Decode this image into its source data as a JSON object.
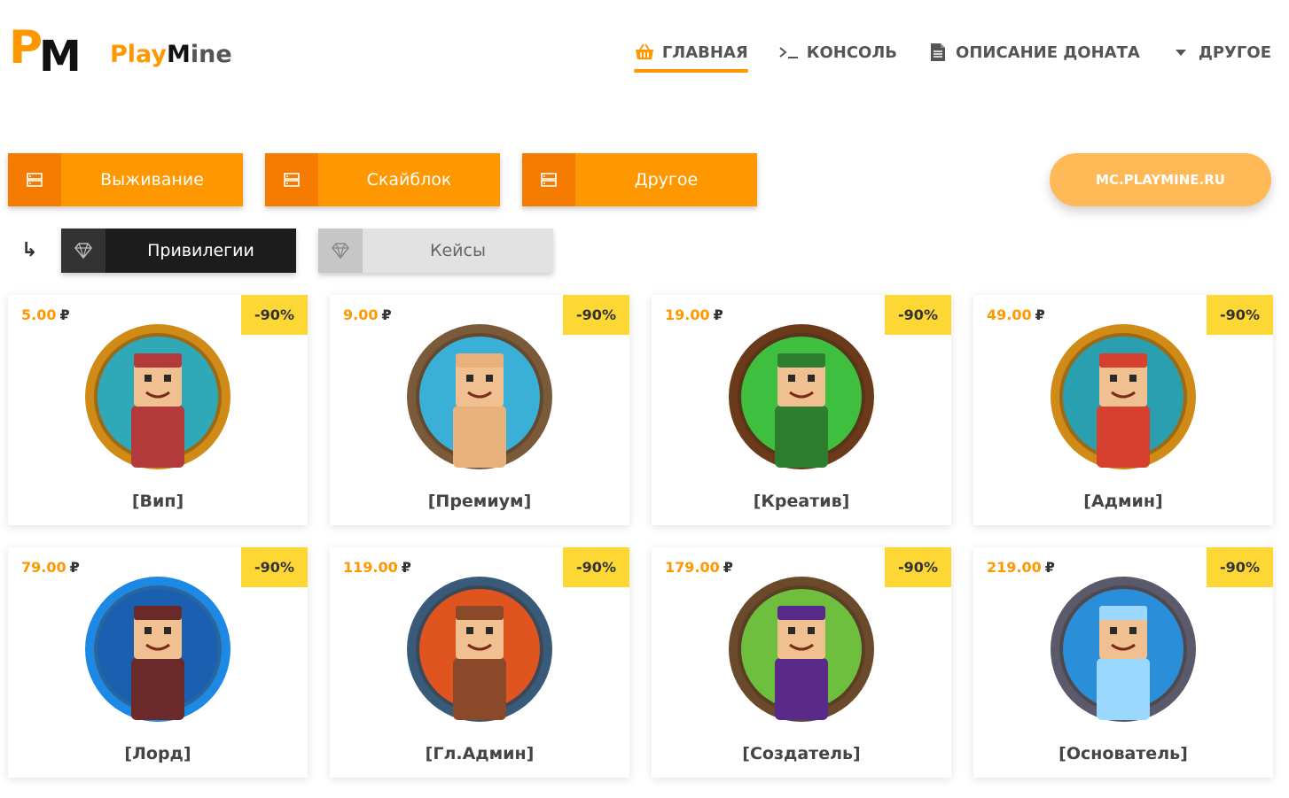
{
  "logo": {
    "mark_p": "P",
    "mark_m": "M",
    "text_part1": "Play",
    "text_part2": "M",
    "text_part3": "ine"
  },
  "nav": [
    {
      "label": "ГЛАВНАЯ",
      "icon": "basket-icon"
    },
    {
      "label": "КОНСОЛЬ",
      "icon": "terminal-icon"
    },
    {
      "label": "ОПИСАНИЕ ДОНАТА",
      "icon": "document-icon"
    },
    {
      "label": "ДРУГОЕ",
      "icon": "caret-down-icon"
    }
  ],
  "servers": [
    {
      "label": "Выживание",
      "icon": "server-icon"
    },
    {
      "label": "Скайблок",
      "icon": "server-icon"
    },
    {
      "label": "Другое",
      "icon": "server-icon"
    }
  ],
  "server_ip": "MC.PLAYMINE.RU",
  "categories": [
    {
      "label": "Привилегии",
      "icon": "diamond-icon",
      "active": true
    },
    {
      "label": "Кейсы",
      "icon": "diamond-icon",
      "active": false
    }
  ],
  "currency": "₽",
  "products": [
    {
      "name": "[Вип]",
      "price": "5.00",
      "discount": "-90%",
      "colors": {
        "ring": "#d08a16",
        "bg": "#2fa9b8",
        "char": "#b33a3a"
      }
    },
    {
      "name": "[Премиум]",
      "price": "9.00",
      "discount": "-90%",
      "colors": {
        "ring": "#7a5a3a",
        "bg": "#3ab0d8",
        "char": "#e8b07a"
      }
    },
    {
      "name": "[Креатив]",
      "price": "19.00",
      "discount": "-90%",
      "colors": {
        "ring": "#6a3a1a",
        "bg": "#3fbf3f",
        "char": "#2f7d2f"
      }
    },
    {
      "name": "[Админ]",
      "price": "49.00",
      "discount": "-90%",
      "colors": {
        "ring": "#d08a16",
        "bg": "#2a9fb0",
        "char": "#d6402f"
      }
    },
    {
      "name": "[Лорд]",
      "price": "79.00",
      "discount": "-90%",
      "colors": {
        "ring": "#1e88e5",
        "bg": "#1a5fb0",
        "char": "#6a2a2a"
      }
    },
    {
      "name": "[Гл.Админ]",
      "price": "119.00",
      "discount": "-90%",
      "colors": {
        "ring": "#3a5a7a",
        "bg": "#e0541f",
        "char": "#8a4a2a"
      }
    },
    {
      "name": "[Создатель]",
      "price": "179.00",
      "discount": "-90%",
      "colors": {
        "ring": "#6a4a2a",
        "bg": "#6fbf3f",
        "char": "#5a2a8a"
      }
    },
    {
      "name": "[Основатель]",
      "price": "219.00",
      "discount": "-90%",
      "colors": {
        "ring": "#5a5a6a",
        "bg": "#2a8fd8",
        "char": "#9ad8ff"
      }
    }
  ]
}
